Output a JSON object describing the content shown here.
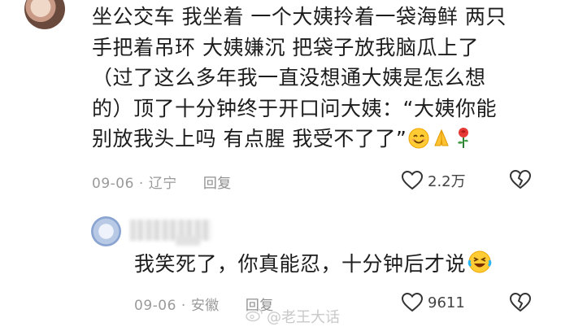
{
  "comment": {
    "lines": [
      "坐公交车 我坐着 一个大姨拎着一袋海鲜 两只",
      "手把着吊环 大姨嫌沉 把袋子放我脑瓜上了",
      "（过了这么多年我一直没想通大姨是怎么想",
      "的）顶了十分钟终于开口问大姨：“大姨你能",
      "别放我头上吗 有点腥 我受不了了”"
    ],
    "emojis": [
      "smiling-face",
      "folded-hands",
      "rose"
    ],
    "date": "09-06",
    "location": "辽宁",
    "reply_label": "回复",
    "like_count": "2.2万"
  },
  "reply": {
    "text": "我笑死了，你真能忍，十分钟后才说",
    "emoji": "rolling-laughing-face",
    "date": "09-06",
    "location": "安徽",
    "reply_label": "回复",
    "like_count": "9611"
  },
  "watermark": {
    "text": "@老王大话"
  },
  "icons": {
    "like": "heart-outline-icon",
    "dislike": "broken-heart-outline-icon"
  },
  "colors": {
    "text": "#1d1d1d",
    "meta": "#9a9a9a",
    "background": "#ffffff"
  }
}
